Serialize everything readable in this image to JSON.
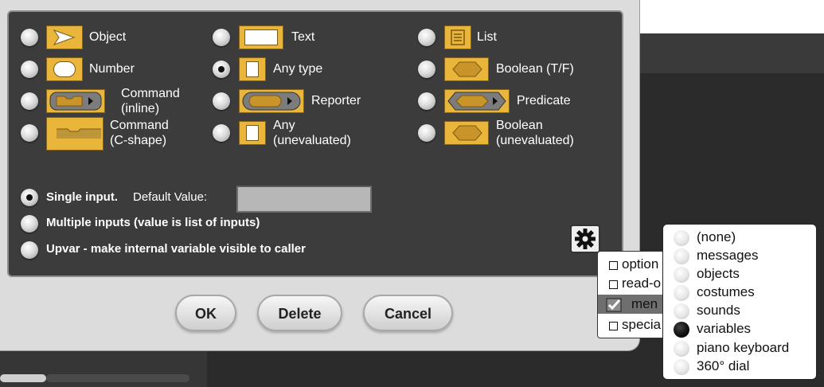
{
  "dialog": {
    "types": [
      {
        "label": "Object",
        "selected": false
      },
      {
        "label": "Text",
        "selected": false
      },
      {
        "label": "List",
        "selected": false
      },
      {
        "label": "Number",
        "selected": false
      },
      {
        "label": "Any type",
        "selected": true
      },
      {
        "label": "Boolean (T/F)",
        "selected": false
      },
      {
        "label_line1": "Command",
        "label_line2": "(inline)",
        "selected": false
      },
      {
        "label": "Reporter",
        "selected": false
      },
      {
        "label": "Predicate",
        "selected": false
      },
      {
        "label_line1": "Command",
        "label_line2": "(C-shape)",
        "selected": false
      },
      {
        "label_line1": "Any",
        "label_line2": "(unevaluated)",
        "selected": false
      },
      {
        "label_line1": "Boolean",
        "label_line2": "(unevaluated)",
        "selected": false
      }
    ],
    "modes": {
      "single": "Single input.",
      "default_value_label": "Default Value:",
      "default_value": "",
      "multiple": "Multiple inputs (value is list of inputs)",
      "upvar": "Upvar - make internal variable visible to caller",
      "selected": "single"
    },
    "buttons": {
      "ok": "OK",
      "delete": "Delete",
      "cancel": "Cancel"
    }
  },
  "context_menu": {
    "items": [
      {
        "label": "option",
        "checked": false
      },
      {
        "label": "read-o",
        "checked": false
      },
      {
        "label": "men",
        "checked": true
      },
      {
        "label": "specia",
        "checked": false
      }
    ]
  },
  "submenu": {
    "items": [
      {
        "label": "(none)",
        "selected": false
      },
      {
        "label": "messages",
        "selected": false
      },
      {
        "label": "objects",
        "selected": false
      },
      {
        "label": "costumes",
        "selected": false
      },
      {
        "label": "sounds",
        "selected": false
      },
      {
        "label": "variables",
        "selected": true
      },
      {
        "label": "piano keyboard",
        "selected": false
      },
      {
        "label": "360° dial",
        "selected": false
      }
    ]
  },
  "colors": {
    "slot": "#e9b53a",
    "panel": "#3c3c3c",
    "dialog": "#dcdcdc"
  }
}
